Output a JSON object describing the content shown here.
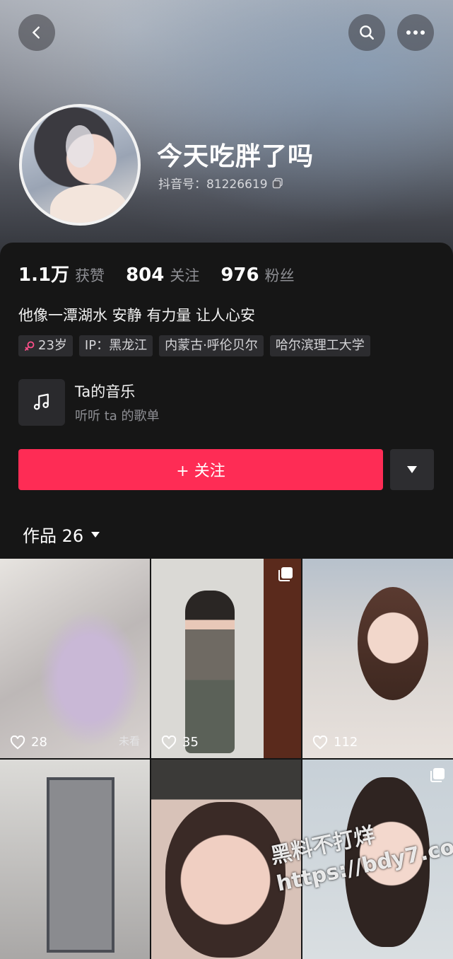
{
  "header": {
    "back_icon": "back-icon",
    "search_icon": "search-icon",
    "more_icon": "more-icon"
  },
  "profile": {
    "nickname": "今天吃胖了吗",
    "douyin_id": "抖音号：81226619",
    "copy_icon": "copy-icon"
  },
  "stats": [
    {
      "value": "1.1万",
      "label": "获赞"
    },
    {
      "value": "804",
      "label": "关注"
    },
    {
      "value": "976",
      "label": "粉丝"
    }
  ],
  "bio": "他像一潭湖水 安静 有力量 让人心安",
  "tags": {
    "age": "23岁",
    "ip": "IP：黑龙江",
    "location": "内蒙古·呼伦贝尔",
    "school": "哈尔滨理工大学"
  },
  "music": {
    "title": "Ta的音乐",
    "subtitle": "听听 ta 的歌单"
  },
  "follow_button": "+ 关注",
  "works": {
    "label": "作品 26"
  },
  "videos": [
    {
      "likes": "28",
      "badge": "未看"
    },
    {
      "likes": "35"
    },
    {
      "likes": "112"
    },
    {
      "likes": ""
    },
    {
      "likes": ""
    },
    {
      "likes": ""
    }
  ],
  "watermark": {
    "line1": "黑料不打烊",
    "line2": "https://bdy7.co"
  },
  "colors": {
    "accent": "#fe2c55",
    "background": "#161616"
  }
}
